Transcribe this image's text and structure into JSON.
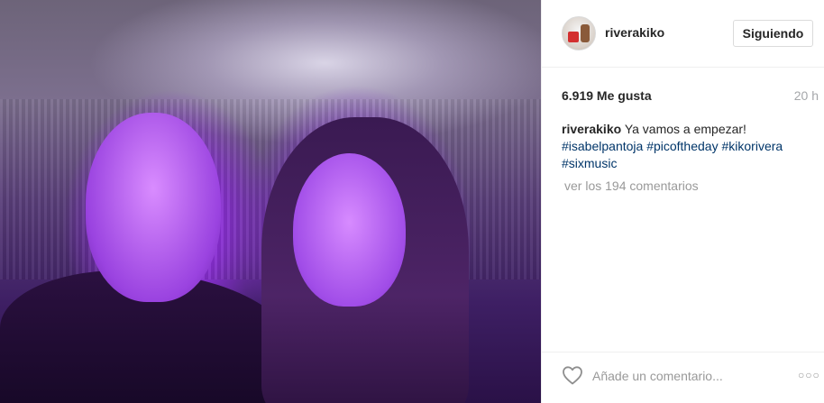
{
  "post": {
    "photo_alt": "",
    "author": {
      "username": "riverakiko",
      "follow_label": "Siguiendo"
    },
    "likes": "6.919 Me gusta",
    "time": "20 h",
    "caption": {
      "username": "riverakiko",
      "text": "Ya vamos a empezar!",
      "hashtags": [
        "#isabelpantoja",
        "#picoftheday",
        "#kikorivera",
        "#sixmusic"
      ]
    },
    "view_comments": "ver los 194 comentarios",
    "comment_placeholder": "Añade un comentario...",
    "icons": {
      "like": "heart-outline-icon",
      "options": "more-options-icon"
    }
  }
}
